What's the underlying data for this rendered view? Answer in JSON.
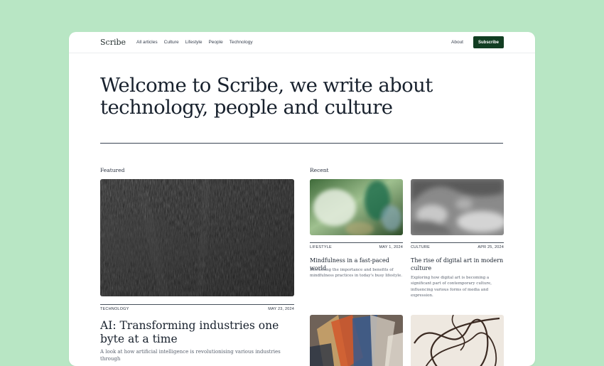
{
  "nav": {
    "logo": "Scribe",
    "links": [
      "All articles",
      "Culture",
      "Lifestyle",
      "People",
      "Technology"
    ],
    "about": "About",
    "subscribe": "Subscribe"
  },
  "hero": {
    "title": "Welcome to Scribe, we write about technology, people and culture"
  },
  "featured": {
    "section_label": "Featured",
    "category": "TECHNOLOGY",
    "date": "MAY 23, 2024",
    "title": "AI: Transforming industries one byte at a time",
    "description": "A look at how artificial intelligence is revolutionising various industries through"
  },
  "recent": {
    "section_label": "Recent",
    "articles": [
      {
        "category": "LIFESTYLE",
        "date": "MAY 1, 2024",
        "title": "Mindfulness in a fast-paced world",
        "description": "Discussing the importance and benefits of mindfulness practices in today's busy lifestyle."
      },
      {
        "category": "CULTURE",
        "date": "APR 25, 2024",
        "title": "The rise of digital art in modern culture",
        "description": "Exploring how digital art is becoming a significant part of contemporary culture, influencing various forms of media and expression."
      }
    ]
  },
  "colors": {
    "background": "#b8e6c4",
    "accent": "#123d22",
    "text": "#18212d"
  }
}
